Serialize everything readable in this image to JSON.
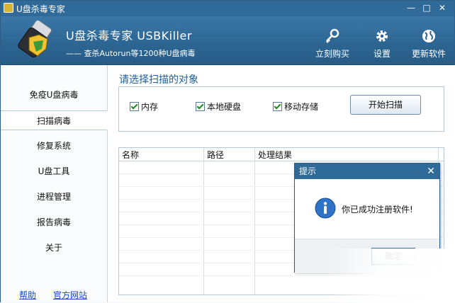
{
  "window": {
    "title": "U盘杀毒专家",
    "minimize": "—",
    "maximize": "□",
    "close": "✕"
  },
  "header": {
    "brand": "U盘杀毒专家   USBKiller",
    "subtitle": "—— 查杀Autorun等1200种U盘病毒",
    "buttons": [
      {
        "label": "立刻购买",
        "icon": "key-icon"
      },
      {
        "label": "设置",
        "icon": "gear-icon"
      },
      {
        "label": "更新软件",
        "icon": "globe-icon"
      }
    ]
  },
  "sidebar": {
    "items": [
      {
        "label": "免疫U盘病毒"
      },
      {
        "label": "扫描病毒",
        "active": true
      },
      {
        "label": "修复系统"
      },
      {
        "label": "U盘工具"
      },
      {
        "label": "进程管理"
      },
      {
        "label": "报告病毒"
      },
      {
        "label": "关于"
      }
    ],
    "links": {
      "help": "帮助",
      "website": "官方网站"
    }
  },
  "main": {
    "section_title": "请选择扫描的对象",
    "checkboxes": [
      {
        "label": "内存",
        "checked": true
      },
      {
        "label": "本地硬盘",
        "checked": true
      },
      {
        "label": "移动存储",
        "checked": true
      }
    ],
    "scan_button": "开始扫描",
    "table": {
      "columns": [
        "名称",
        "路径",
        "处理结果"
      ]
    }
  },
  "dialog": {
    "title": "提示",
    "close": "✕",
    "message": "你已成功注册软件!",
    "ok_button": "确定"
  },
  "colors": {
    "titlebar": "#2f6a98",
    "accent_text": "#1c5fa0",
    "link": "#1447c8"
  }
}
